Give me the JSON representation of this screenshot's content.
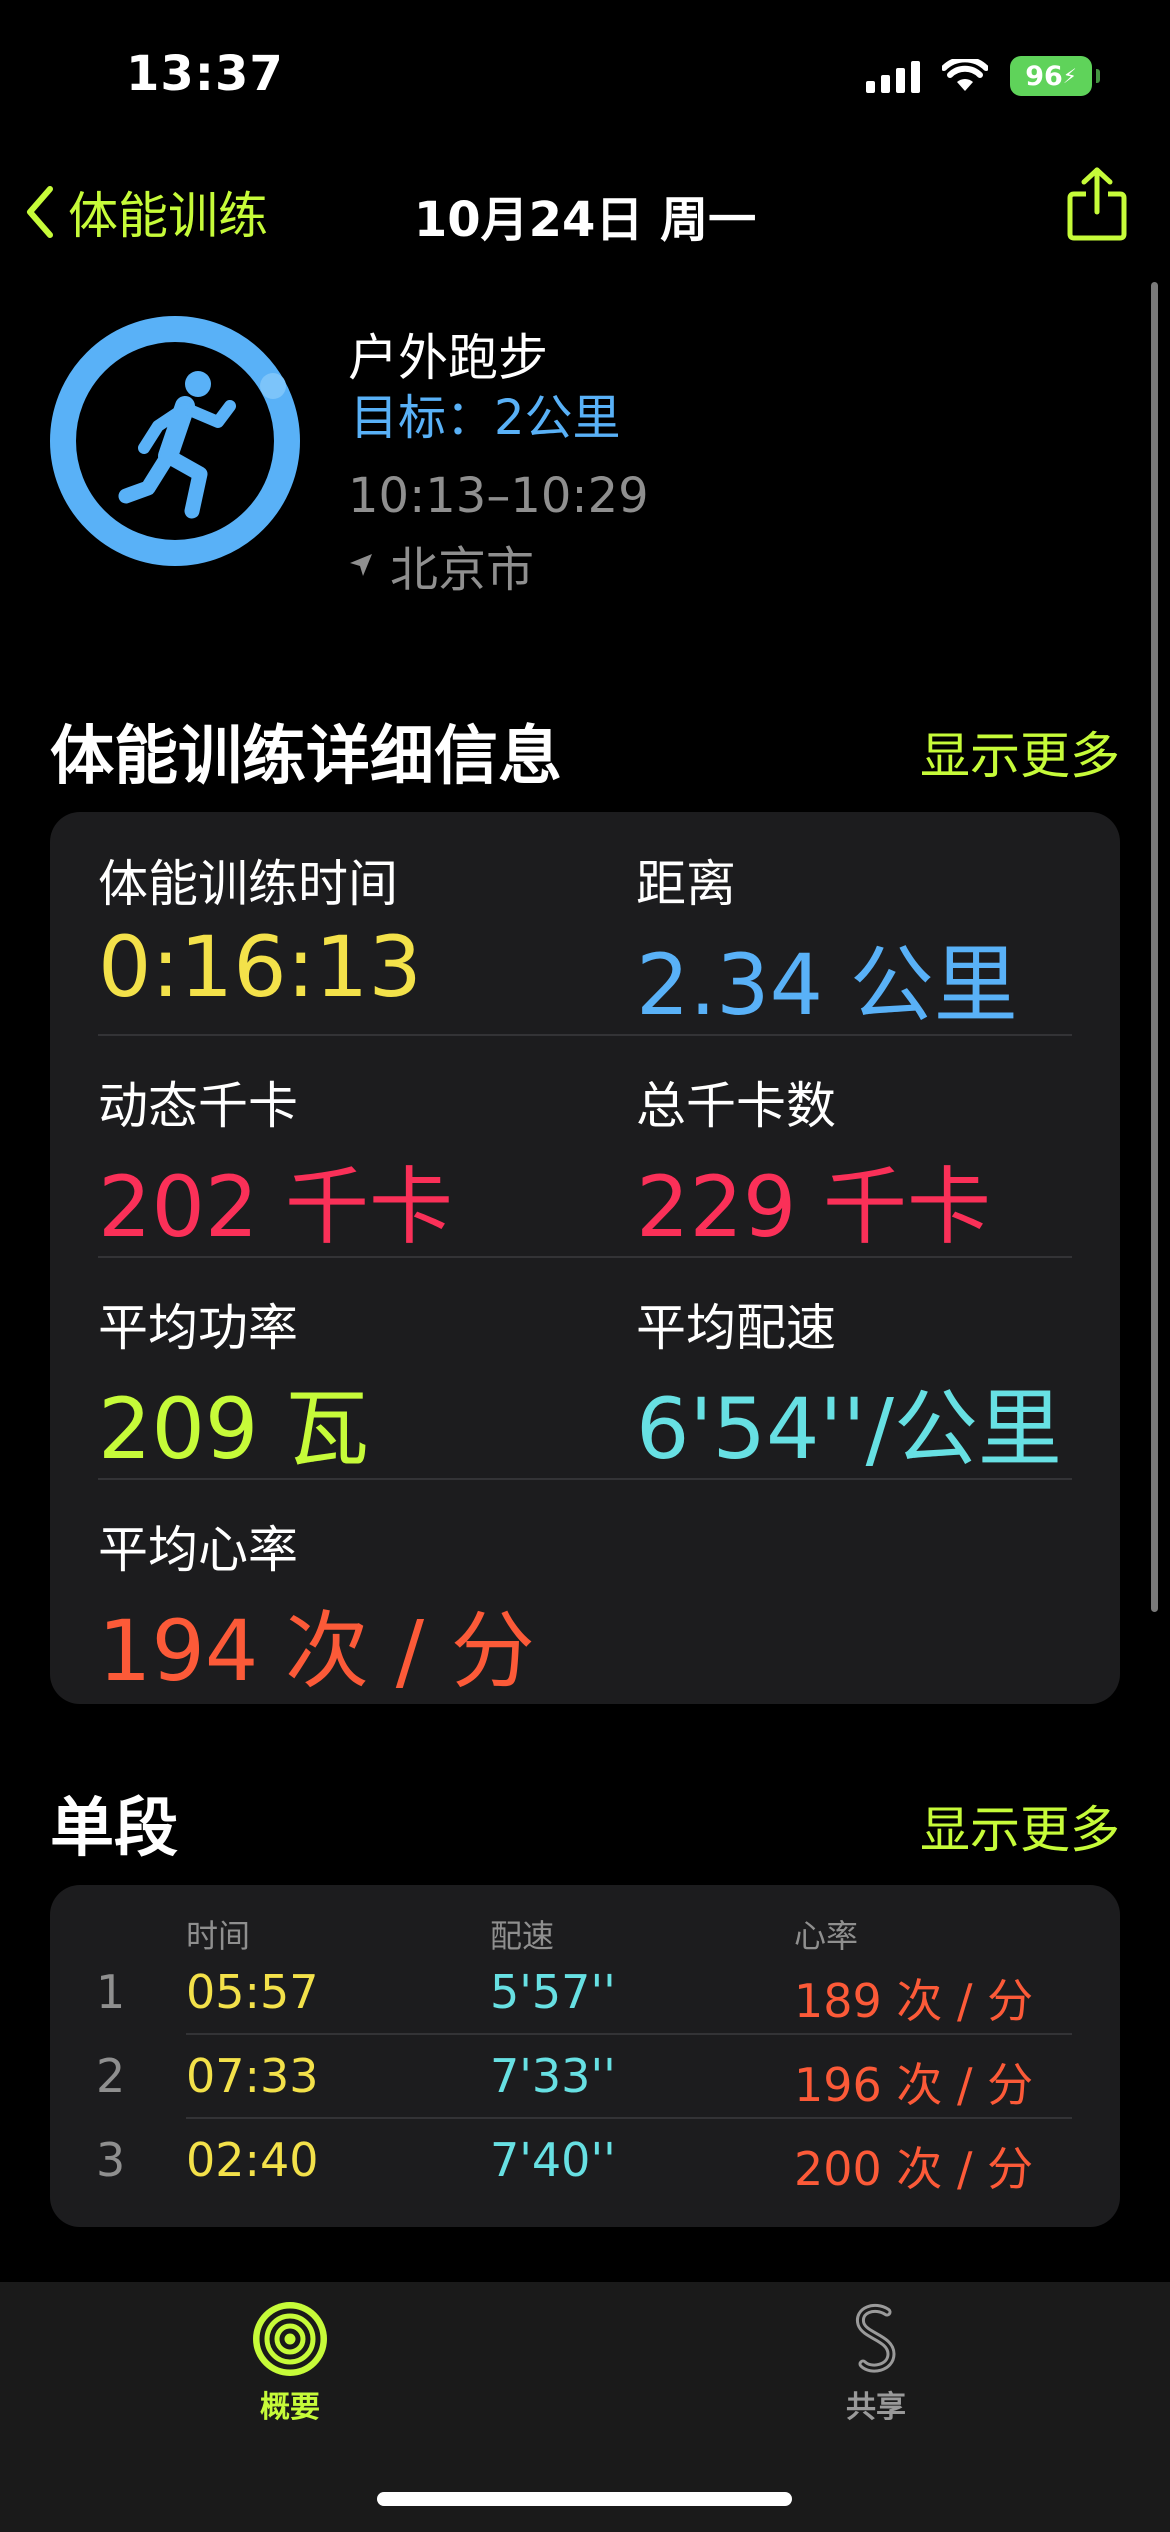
{
  "status_bar": {
    "time": "13:37",
    "battery": "96"
  },
  "nav": {
    "back_label": "体能训练",
    "title": "10月24日 周一"
  },
  "workout": {
    "name": "户外跑步",
    "goal": "目标：2公里",
    "time_range": "10:13–10:29",
    "location": "北京市"
  },
  "details": {
    "title": "体能训练详细信息",
    "more_label": "显示更多",
    "metrics": [
      {
        "label": "体能训练时间",
        "value": "0:16:13",
        "color": "#f3e14a"
      },
      {
        "label": "距离",
        "value": "2.34 公里",
        "color": "#59b1f7"
      },
      {
        "label": "动态千卡",
        "value": "202 千卡",
        "color": "#fa3058"
      },
      {
        "label": "总千卡数",
        "value": "229 千卡",
        "color": "#fa3058"
      },
      {
        "label": "平均功率",
        "value": "209 瓦",
        "color": "#c6fb39"
      },
      {
        "label": "平均配速",
        "value": "6'54''/公里",
        "color": "#67e0e3"
      },
      {
        "label": "平均心率",
        "value": "194 次 / 分",
        "color": "#fc5a38"
      }
    ]
  },
  "laps": {
    "title": "单段",
    "more_label": "显示更多",
    "headers": {
      "time": "时间",
      "pace": "配速",
      "hr": "心率"
    },
    "rows": [
      {
        "num": "1",
        "time": "05:57",
        "pace": "5'57''",
        "hr": "189 次 / 分"
      },
      {
        "num": "2",
        "time": "07:33",
        "pace": "7'33''",
        "hr": "196 次 / 分"
      },
      {
        "num": "3",
        "time": "02:40",
        "pace": "7'40''",
        "hr": "200 次 / 分"
      }
    ]
  },
  "tabs": [
    {
      "label": "概要",
      "icon": "activity-rings-icon",
      "active": true
    },
    {
      "label": "共享",
      "icon": "sharing-icon",
      "active": false
    }
  ],
  "colors": {
    "accent": "#c6fb39",
    "ring": "#59b1f7",
    "time": "#f3e14a",
    "pace": "#67e0e3",
    "heart": "#fc5a38"
  }
}
